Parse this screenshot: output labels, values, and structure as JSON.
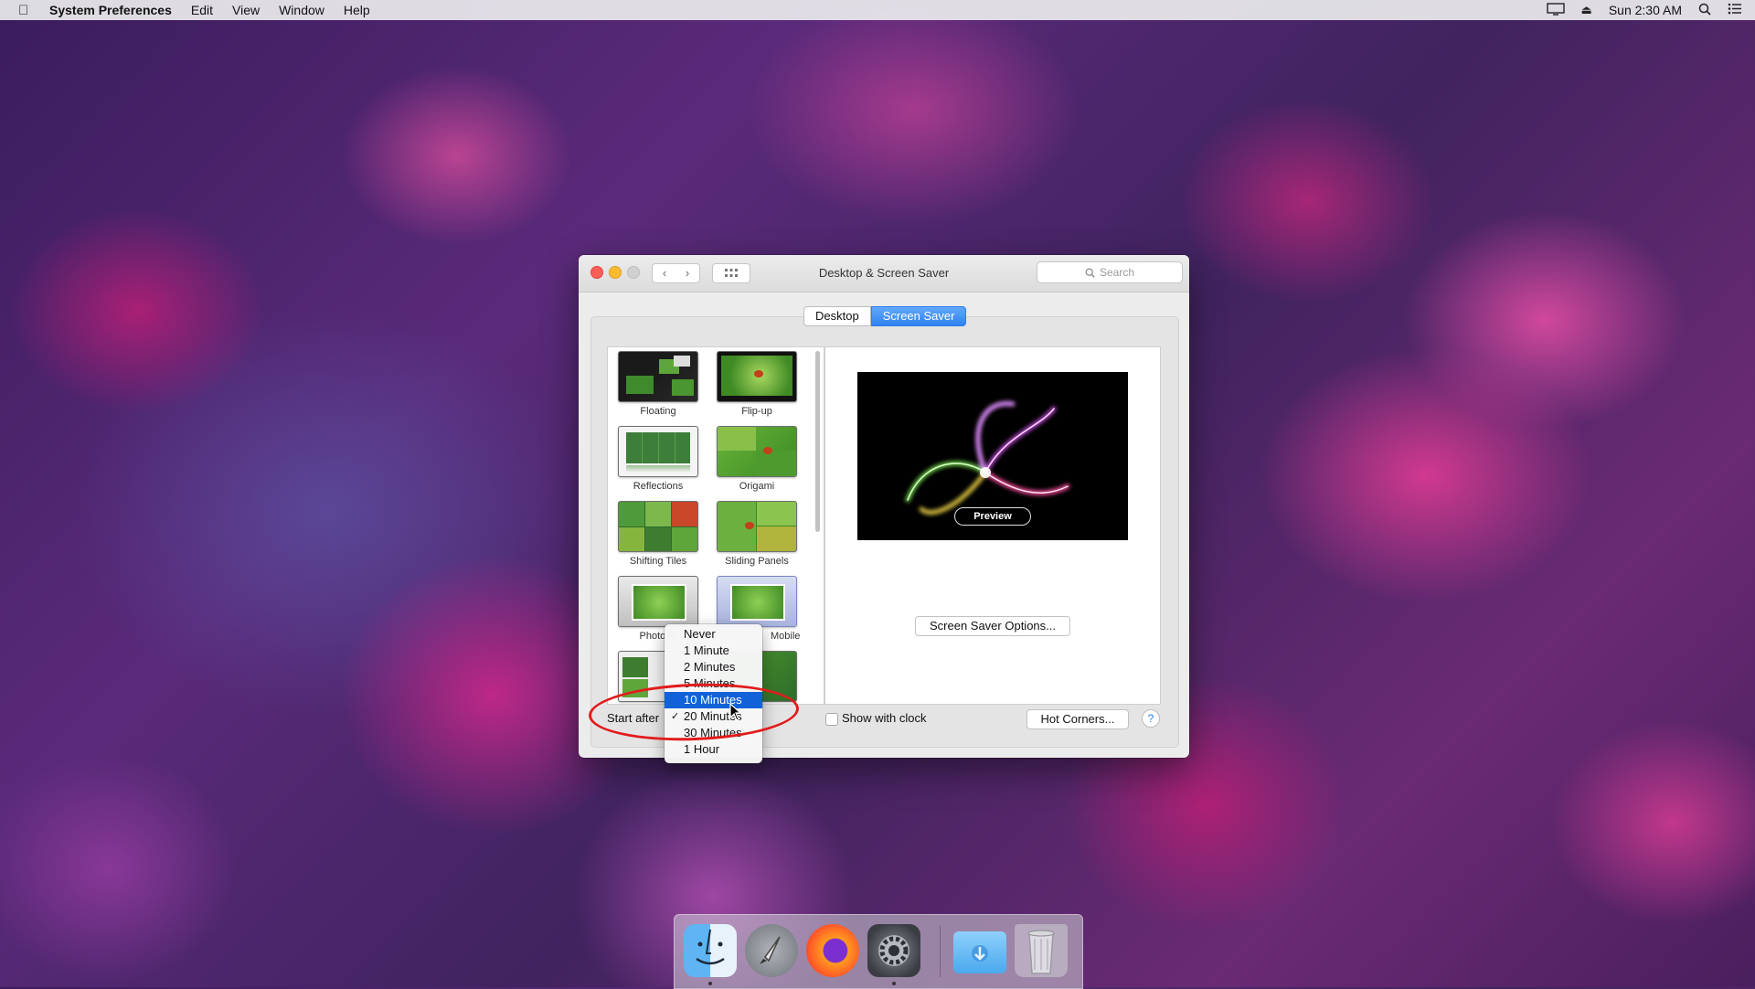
{
  "menubar": {
    "app_name": "System Preferences",
    "menus": [
      "Edit",
      "View",
      "Window",
      "Help"
    ],
    "clock": "Sun 2:30 AM"
  },
  "window": {
    "title": "Desktop & Screen Saver",
    "search_placeholder": "Search",
    "tabs": [
      {
        "label": "Desktop",
        "active": false
      },
      {
        "label": "Screen Saver",
        "active": true
      }
    ]
  },
  "screensavers": [
    {
      "label": "Floating"
    },
    {
      "label": "Flip-up"
    },
    {
      "label": "Reflections"
    },
    {
      "label": "Origami"
    },
    {
      "label": "Shifting Tiles"
    },
    {
      "label": "Sliding Panels"
    },
    {
      "label": "Photo M"
    },
    {
      "label": "Mobile"
    }
  ],
  "preview": {
    "button_label": "Preview",
    "options_button": "Screen Saver Options..."
  },
  "bottom": {
    "start_after_label": "Start after",
    "show_clock_label": "Show with clock",
    "show_clock_checked": false,
    "hot_corners_button": "Hot Corners...",
    "help": "?"
  },
  "start_after_menu": {
    "items": [
      {
        "label": "Never"
      },
      {
        "label": "1 Minute"
      },
      {
        "label": "2 Minutes"
      },
      {
        "label": "5 Minutes"
      },
      {
        "label": "10 Minutes"
      },
      {
        "label": "20 Minutes"
      },
      {
        "label": "30 Minutes"
      },
      {
        "label": "1 Hour"
      }
    ],
    "highlighted": "10 Minutes",
    "checked": "20 Minutes"
  },
  "dock": {
    "apps": [
      "Finder",
      "Launchpad",
      "Firefox",
      "System Preferences",
      "Downloads",
      "Trash"
    ]
  }
}
